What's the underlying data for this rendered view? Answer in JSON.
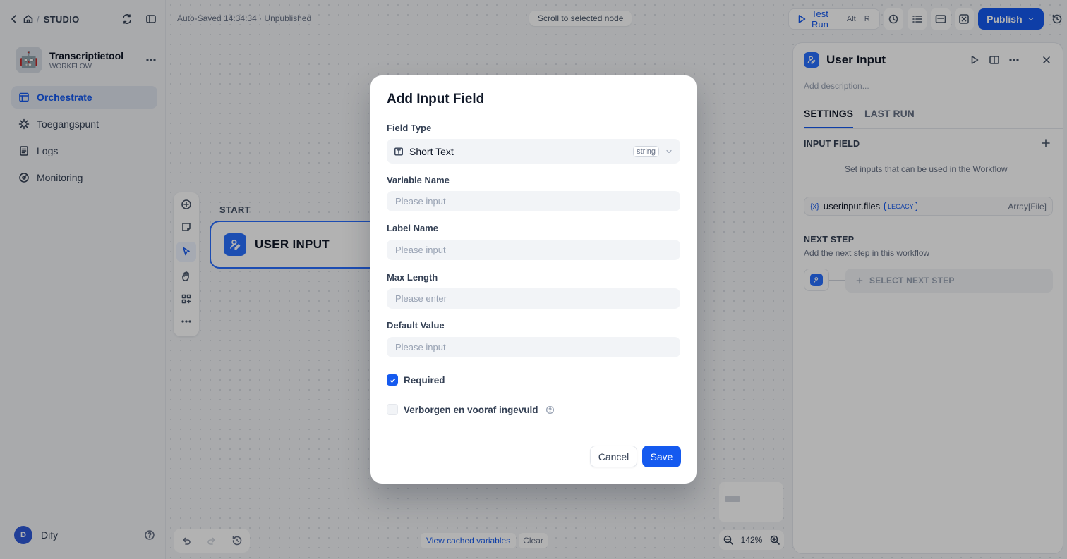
{
  "sidebar": {
    "header": "STUDIO",
    "app": {
      "name": "Transcriptietool",
      "type": "WORKFLOW",
      "avatar": "🤖"
    },
    "nav": [
      {
        "label": "Orchestrate",
        "icon": "orchestrate-icon",
        "active": true
      },
      {
        "label": "Toegangspunt",
        "icon": "access-point-icon",
        "active": false
      },
      {
        "label": "Logs",
        "icon": "logs-icon",
        "active": false
      },
      {
        "label": "Monitoring",
        "icon": "monitoring-icon",
        "active": false
      }
    ],
    "user": {
      "initial": "D",
      "name": "Dify"
    }
  },
  "topbar": {
    "status": "Auto-Saved 14:34:34 · Unpublished",
    "scroll_hint": "Scroll to selected node",
    "test_run": "Test Run",
    "shortcut_alt": "Alt",
    "shortcut_key": "R",
    "publish": "Publish"
  },
  "canvas": {
    "node_section": "START",
    "node_title": "USER INPUT",
    "cached_variables": "View cached variables",
    "clear": "Clear",
    "zoom": "142%"
  },
  "panel": {
    "title": "User Input",
    "description_placeholder": "Add description...",
    "tabs": [
      "SETTINGS",
      "LAST RUN"
    ],
    "input_field_title": "INPUT FIELD",
    "input_field_hint": "Set inputs that can be used in the Workflow",
    "variable": {
      "prefix": "{x}",
      "name": "userinput.files",
      "badge": "LEGACY",
      "type": "Array[File]"
    },
    "next_step_title": "NEXT STEP",
    "next_step_hint": "Add the next step in this workflow",
    "select_next": "SELECT NEXT STEP"
  },
  "modal": {
    "title": "Add Input Field",
    "field_type_label": "Field Type",
    "field_type_value": "Short Text",
    "field_type_badge": "string",
    "variable_name_label": "Variable Name",
    "variable_name_placeholder": "Please input",
    "label_name_label": "Label Name",
    "label_name_placeholder": "Please input",
    "max_length_label": "Max Length",
    "max_length_placeholder": "Please enter",
    "default_value_label": "Default Value",
    "default_value_placeholder": "Please input",
    "required_label": "Required",
    "required_checked": true,
    "hidden_label": "Verborgen en vooraf ingevuld",
    "hidden_checked": false,
    "cancel": "Cancel",
    "save": "Save"
  },
  "colors": {
    "accent": "#155aef",
    "overlay": "rgba(0,0,0,0.30)"
  }
}
